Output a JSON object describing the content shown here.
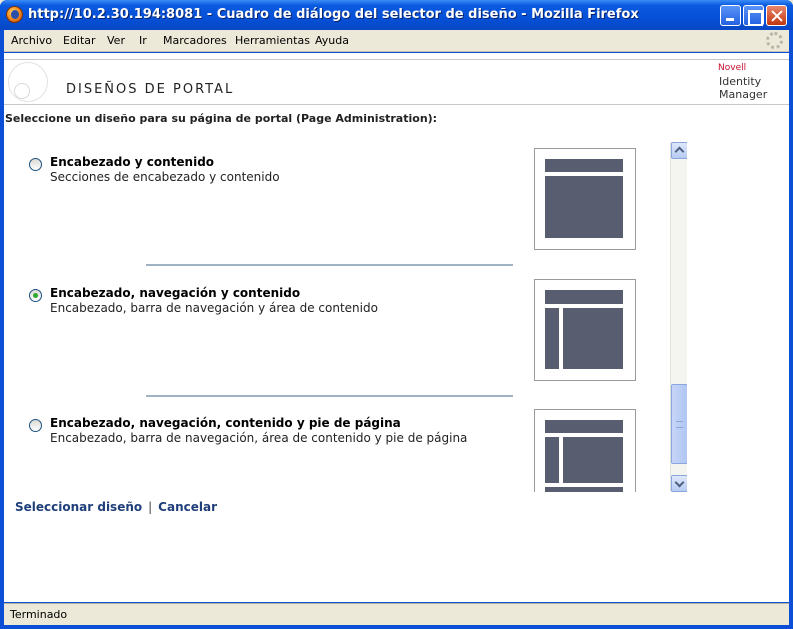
{
  "window": {
    "title": "http://10.2.30.194:8081 - Cuadro de diálogo del selector de diseño - Mozilla Firefox"
  },
  "menu": {
    "items": [
      "Archivo",
      "Editar",
      "Ver",
      "Ir",
      "Marcadores",
      "Herramientas",
      "Ayuda"
    ]
  },
  "banner": {
    "title": "DISEÑOS DE PORTAL",
    "logo_brand": "Novell",
    "logo_line1": "Identity",
    "logo_line2": "Manager"
  },
  "intro": "Seleccione un diseño para su página de portal (Page Administration):",
  "layouts": [
    {
      "title": "Encabezado y contenido",
      "description": "Secciones de encabezado y contenido",
      "selected": false
    },
    {
      "title": "Encabezado, navegación y contenido",
      "description": "Encabezado, barra de navegación y área de contenido",
      "selected": true
    },
    {
      "title": "Encabezado, navegación, contenido y pie de página",
      "description": "Encabezado, barra de navegación, área de contenido y pie de página",
      "selected": false
    }
  ],
  "actions": {
    "select_label": "Seleccionar diseño",
    "separator": "|",
    "cancel_label": "Cancelar"
  },
  "status": "Terminado",
  "colors": {
    "title_bar": "#0550d8",
    "thumbnail_block": "#585d70",
    "link": "#1f3f7a",
    "divider": "#9fb3c4"
  }
}
